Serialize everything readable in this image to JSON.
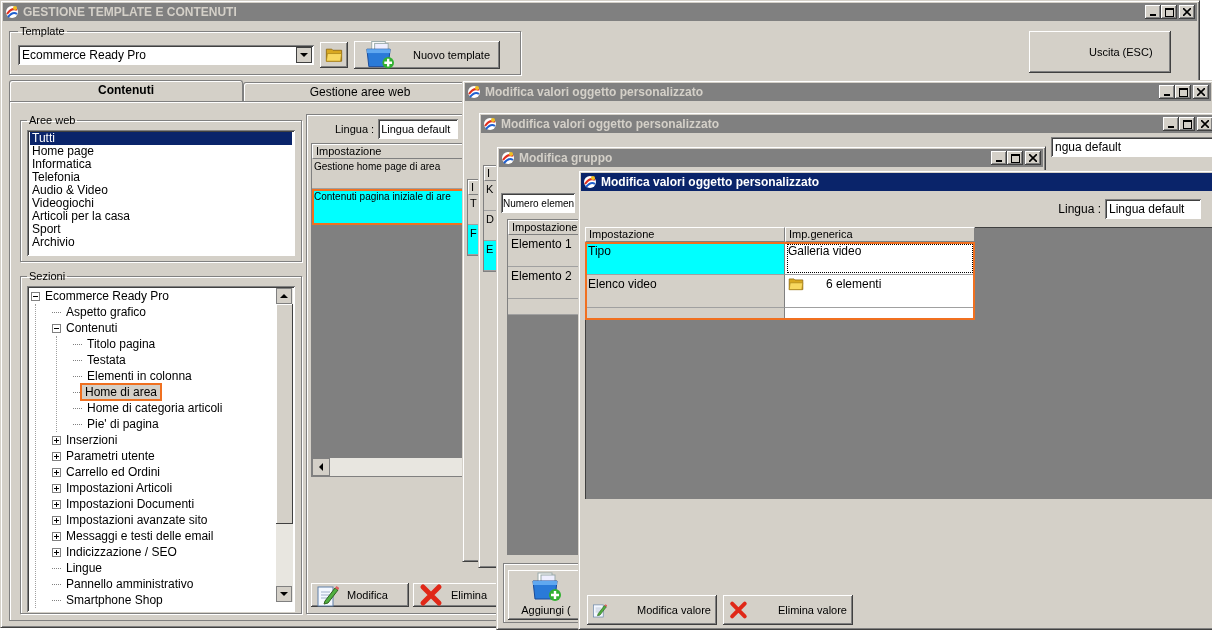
{
  "main_window": {
    "title": "GESTIONE TEMPLATE E CONTENUTI",
    "active": false,
    "template": {
      "label": "Template",
      "value": "Ecommerce Ready Pro",
      "new_button": "Nuovo template"
    },
    "exit_button": "Uscita (ESC)",
    "tabs": [
      {
        "label": "Contenuti",
        "selected": true
      },
      {
        "label": "Gestione aree web",
        "selected": false
      }
    ],
    "areas": {
      "label": "Aree web",
      "items": [
        {
          "label": "Tutti",
          "selected": true
        },
        {
          "label": "Home page",
          "selected": false
        },
        {
          "label": "Informatica",
          "selected": false
        },
        {
          "label": "Telefonia",
          "selected": false
        },
        {
          "label": "Audio & Video",
          "selected": false
        },
        {
          "label": "Videogiochi",
          "selected": false
        },
        {
          "label": "Articoli per la casa",
          "selected": false
        },
        {
          "label": "Sport",
          "selected": false
        },
        {
          "label": "Archivio",
          "selected": false
        }
      ]
    },
    "sections": {
      "label": "Sezioni",
      "tree": [
        {
          "label": "Ecommerce Ready Pro",
          "selected": false,
          "highlighted": false,
          "expanded": true,
          "children": [
            {
              "label": "Aspetto grafico",
              "selected": false,
              "highlighted": false
            },
            {
              "label": "Contenuti",
              "selected": false,
              "highlighted": false,
              "expanded": true,
              "children": [
                {
                  "label": "Titolo pagina",
                  "selected": false,
                  "highlighted": false
                },
                {
                  "label": "Testata",
                  "selected": false,
                  "highlighted": false
                },
                {
                  "label": "Elementi in colonna",
                  "selected": false,
                  "highlighted": false
                },
                {
                  "label": "Home di area",
                  "selected": true,
                  "highlighted": true
                },
                {
                  "label": "Home di categoria articoli",
                  "selected": false,
                  "highlighted": false
                },
                {
                  "label": "Pie' di pagina",
                  "selected": false,
                  "highlighted": false
                }
              ]
            },
            {
              "label": "Inserzioni",
              "selected": false,
              "highlighted": false,
              "expanded": false
            },
            {
              "label": "Parametri utente",
              "selected": false,
              "highlighted": false,
              "expanded": false
            },
            {
              "label": "Carrello ed Ordini",
              "selected": false,
              "highlighted": false,
              "expanded": false
            },
            {
              "label": "Impostazioni Articoli",
              "selected": false,
              "highlighted": false,
              "expanded": false
            },
            {
              "label": "Impostazioni Documenti",
              "selected": false,
              "highlighted": false,
              "expanded": false
            },
            {
              "label": "Impostazioni avanzate sito",
              "selected": false,
              "highlighted": false,
              "expanded": false
            },
            {
              "label": "Messaggi e testi delle email",
              "selected": false,
              "highlighted": false,
              "expanded": false
            },
            {
              "label": "Indicizzazione / SEO",
              "selected": false,
              "highlighted": false,
              "expanded": false
            },
            {
              "label": "Lingue",
              "selected": false,
              "highlighted": false
            },
            {
              "label": "Pannello amministrativo",
              "selected": false,
              "highlighted": false
            },
            {
              "label": "Smartphone Shop",
              "selected": false,
              "highlighted": false
            }
          ]
        }
      ]
    },
    "settings": {
      "language_label": "Lingua :",
      "language": "Lingua default",
      "column": "Impostazione",
      "rows": [
        {
          "label": "Gestione home page di area",
          "selected": false,
          "highlighted": false
        },
        {
          "label": "Contenuti pagina iniziale di are",
          "selected": true,
          "highlighted": true
        }
      ],
      "buttons": [
        {
          "kind": "edit",
          "label": "Modifica"
        },
        {
          "kind": "delete",
          "label": "Elimina"
        }
      ]
    }
  },
  "background_windows": [
    {
      "title": "Modifica valori oggetto personalizzato",
      "active": false,
      "column": "I",
      "rows": [
        {
          "text": "T",
          "selected": false
        },
        {
          "text": "F",
          "selected": true
        }
      ]
    },
    {
      "title": "Modifica valori oggetto personalizzato",
      "active": false,
      "language": "ngua default",
      "column": "I",
      "rows": [
        {
          "text": "K",
          "selected": false
        },
        {
          "text": "D",
          "selected": false
        },
        {
          "text": "E",
          "selected": true
        }
      ]
    }
  ],
  "group_window": {
    "title": "Modifica gruppo",
    "active": false,
    "count_field": "Numero elemen",
    "column": "Impostazione",
    "rows": [
      {
        "label": "Elemento 1",
        "selected": false
      },
      {
        "label": "Elemento 2",
        "selected": false
      }
    ],
    "add_button": "Aggiungi ("
  },
  "value_window": {
    "title": "Modifica valori oggetto personalizzato",
    "active": true,
    "language_label": "Lingua :",
    "language": "Lingua default",
    "columns": [
      "Impostazione",
      "Imp.generica"
    ],
    "highlighted": true,
    "rows": [
      {
        "label": "Tipo",
        "kind": "text",
        "value": "Galleria video",
        "selected": true
      },
      {
        "label": "Elenco video",
        "kind": "folder",
        "value": "6 elementi",
        "selected": false
      }
    ],
    "buttons": [
      {
        "kind": "edit",
        "label": "Modifica valore"
      },
      {
        "kind": "delete",
        "label": "Elimina valore"
      }
    ]
  }
}
